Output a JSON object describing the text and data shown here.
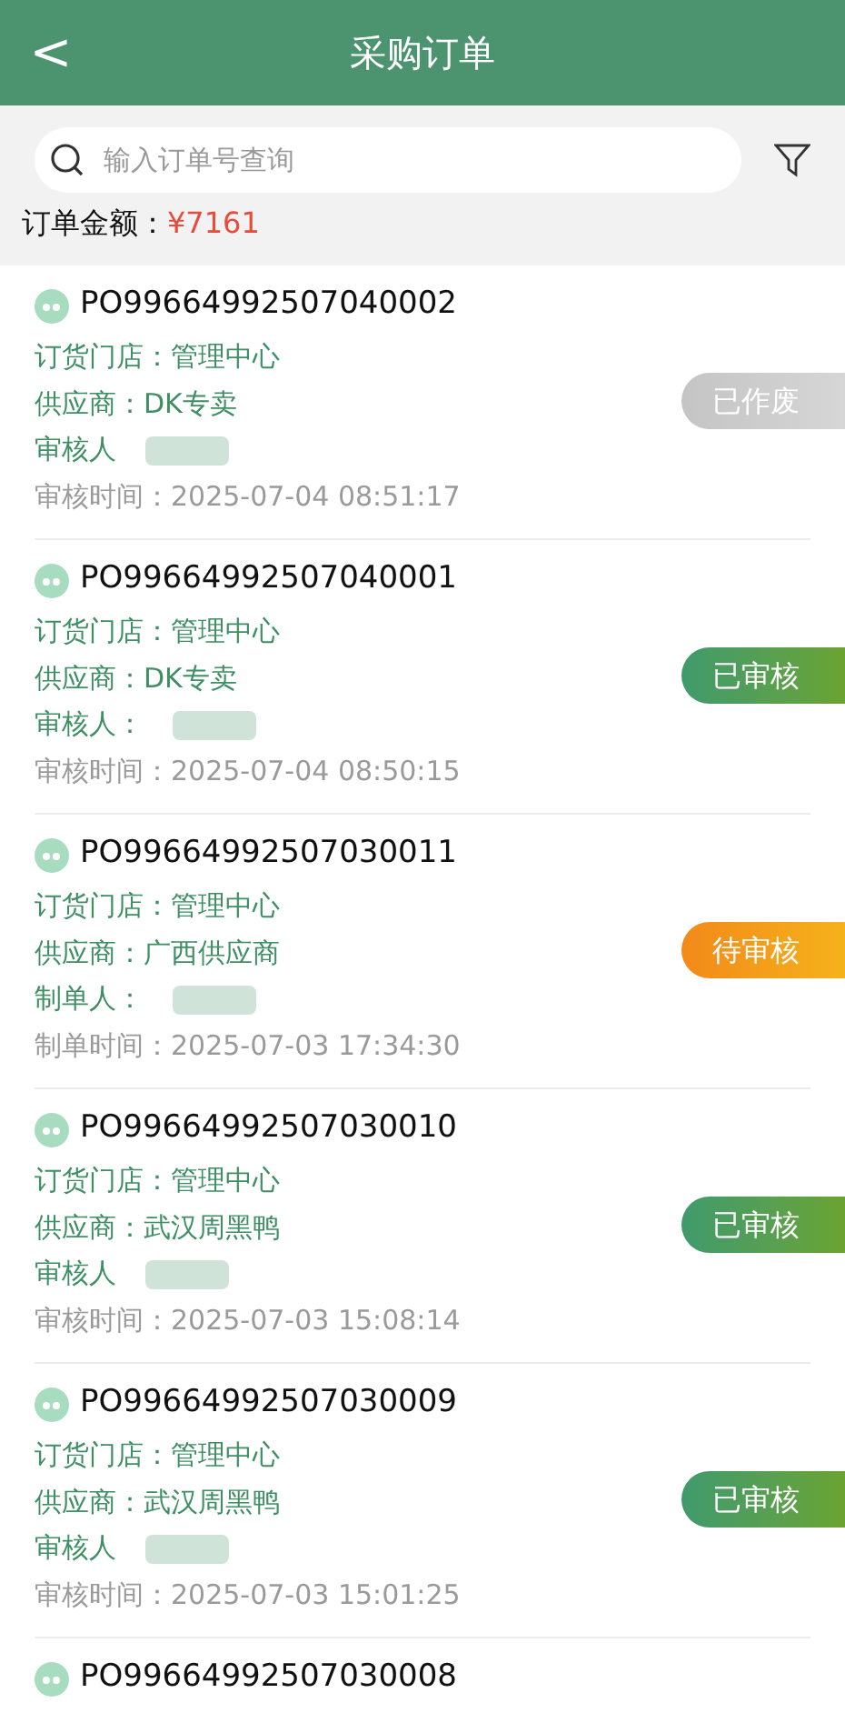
{
  "header": {
    "title": "采购订单",
    "back_icon": "<"
  },
  "search": {
    "placeholder": "输入订单号查询"
  },
  "summary": {
    "label": "订单金额：",
    "amount": "¥7161"
  },
  "orders": [
    {
      "number": "PO99664992507040002",
      "store_label": "订货门店：",
      "store": "管理中心",
      "supplier_label": "供应商：",
      "supplier": "DK专卖",
      "person_label": "审核人",
      "time_label": "审核时间：",
      "time": "2025-07-04 08:51:17",
      "status": "已作废",
      "kind": "voided"
    },
    {
      "number": "PO99664992507040001",
      "store_label": "订货门店：",
      "store": "管理中心",
      "supplier_label": "供应商：",
      "supplier": "DK专卖",
      "person_label": "审核人：",
      "time_label": "审核时间：",
      "time": "2025-07-04 08:50:15",
      "status": "已审核",
      "kind": "approved"
    },
    {
      "number": "PO99664992507030011",
      "store_label": "订货门店：",
      "store": "管理中心",
      "supplier_label": "供应商：",
      "supplier": "广西供应商",
      "person_label": "制单人：",
      "time_label": "制单时间：",
      "time": "2025-07-03 17:34:30",
      "status": "待审核",
      "kind": "pending"
    },
    {
      "number": "PO99664992507030010",
      "store_label": "订货门店：",
      "store": "管理中心",
      "supplier_label": "供应商：",
      "supplier": "武汉周黑鸭",
      "person_label": "审核人",
      "time_label": "审核时间：",
      "time": "2025-07-03 15:08:14",
      "status": "已审核",
      "kind": "approved"
    },
    {
      "number": "PO99664992507030009",
      "store_label": "订货门店：",
      "store": "管理中心",
      "supplier_label": "供应商：",
      "supplier": "武汉周黑鸭",
      "person_label": "审核人",
      "time_label": "审核时间：",
      "time": "2025-07-03 15:01:25",
      "status": "已审核",
      "kind": "approved"
    },
    {
      "number": "PO99664992507030008"
    }
  ]
}
